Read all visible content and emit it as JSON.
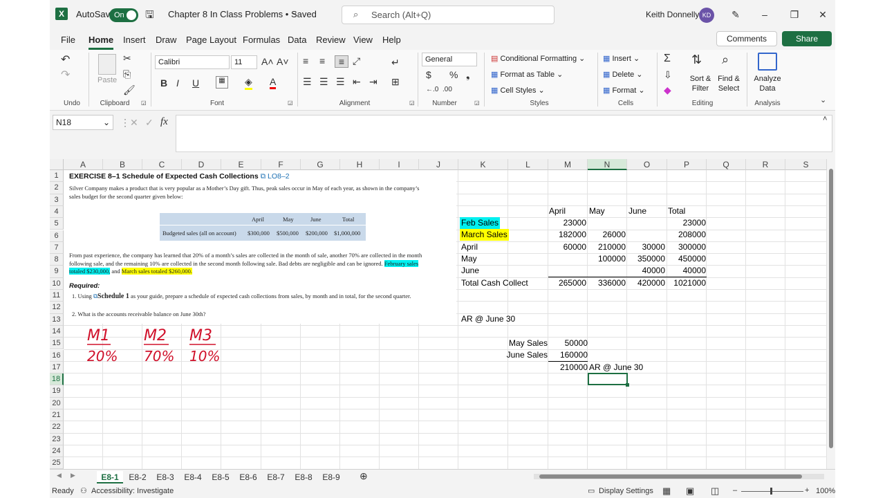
{
  "title_bar": {
    "autosave_label": "AutoSave",
    "autosave_state": "On",
    "doc_title": "Chapter 8 In Class Problems • Saved",
    "search_placeholder": "Search (Alt+Q)",
    "user_name": "Keith Donnelly",
    "user_initials": "KD"
  },
  "menu": [
    "File",
    "Home",
    "Insert",
    "Draw",
    "Page Layout",
    "Formulas",
    "Data",
    "Review",
    "View",
    "Help"
  ],
  "menu_active": "Home",
  "comments_label": "Comments",
  "share_label": "Share",
  "ribbon": {
    "undo_label": "Undo",
    "paste_label": "Paste",
    "clipboard_label": "Clipboard",
    "font_name": "Calibri",
    "font_size": "11",
    "font_label": "Font",
    "alignment_label": "Alignment",
    "number_format": "General",
    "number_label": "Number",
    "cond_format": "Conditional Formatting",
    "format_table": "Format as Table",
    "cell_styles": "Cell Styles",
    "styles_label": "Styles",
    "insert": "Insert",
    "delete": "Delete",
    "format": "Format",
    "cells_label": "Cells",
    "sort_filter_1": "Sort &",
    "sort_filter_2": "Filter",
    "find_select_1": "Find &",
    "find_select_2": "Select",
    "editing_label": "Editing",
    "analyze_1": "Analyze",
    "analyze_2": "Data",
    "analysis_label": "Analysis"
  },
  "name_box": "N18",
  "columns": [
    "A",
    "B",
    "C",
    "D",
    "E",
    "F",
    "G",
    "H",
    "I",
    "J",
    "K",
    "L",
    "M",
    "N",
    "O",
    "P",
    "Q",
    "R",
    "S"
  ],
  "rows": [
    "1",
    "2",
    "3",
    "4",
    "5",
    "6",
    "7",
    "8",
    "9",
    "10",
    "11",
    "12",
    "13",
    "14",
    "15",
    "16",
    "17",
    "18",
    "19",
    "20",
    "21",
    "22",
    "23",
    "24",
    "25"
  ],
  "exercise": {
    "heading": "EXERCISE 8–1 Schedule of Expected Cash Collections",
    "lo": "LO8–2",
    "intro": "Silver Company makes a product that is very popular as a Mother’s Day gift. Thus, peak sales occur in May of each year, as shown in the company’s sales budget for the second quarter given below:",
    "table_headers": [
      "April",
      "May",
      "June",
      "Total"
    ],
    "table_row_label": "Budgeted sales (all on account)",
    "table_values": [
      "$300,000",
      "$500,000",
      "$200,000",
      "$1,000,000"
    ],
    "para1": "From past experience, the company has learned that 20% of a month’s sales are collected in the month of sale, another 70% are collected in the month following sale, and the remaining 10% are collected in the second month following sale. Bad debts are negligible and can be ignored.",
    "feb_text": "February sales totaled $230,000,",
    "and_text": " and ",
    "mar_text": "March sales totaled $260,000.",
    "required": "Required:",
    "req1_a": "1. Using",
    "req1_b": "Schedule 1",
    "req1_c": "as your guide, prepare a schedule of expected cash collections from sales, by month and in total, for the second quarter.",
    "req2": "2. What is the accounts receivable balance on June 30th?"
  },
  "handwriting": [
    "M1",
    "20%",
    "M2",
    "70%",
    "M3",
    "10%"
  ],
  "schedule": {
    "headers": [
      "April",
      "May",
      "June",
      "Total"
    ],
    "rows": [
      {
        "label": "Feb Sales",
        "values": [
          "23000",
          "",
          "",
          "23000"
        ]
      },
      {
        "label": "March Sales",
        "values": [
          "182000",
          "26000",
          "",
          "208000"
        ]
      },
      {
        "label": "April",
        "values": [
          "60000",
          "210000",
          "30000",
          "300000"
        ]
      },
      {
        "label": "May",
        "values": [
          "",
          "100000",
          "350000",
          "450000"
        ]
      },
      {
        "label": "June",
        "values": [
          "",
          "",
          "40000",
          "40000"
        ]
      },
      {
        "label": "Total Cash Collect",
        "values": [
          "265000",
          "336000",
          "420000",
          "1021000"
        ]
      }
    ],
    "ar_label": "AR @ June 30",
    "may_sales_label": "May Sales",
    "may_sales_value": "50000",
    "june_sales_label": "June Sales",
    "june_sales_value": "160000",
    "ar_total": "210000",
    "ar_total_label": "AR @ June 30"
  },
  "tabs": [
    "E8-1",
    "E8-2",
    "E8-3",
    "E8-4",
    "E8-5",
    "E8-6",
    "E8-7",
    "E8-8",
    "E8-9"
  ],
  "active_tab": "E8-1",
  "status": {
    "ready": "Ready",
    "accessibility": "Accessibility: Investigate",
    "display_settings": "Display Settings",
    "zoom": "100%"
  },
  "colors": {
    "excel_green": "#1d6f42",
    "highlight_cyan": "#00f0f0",
    "highlight_yellow": "#ffff00",
    "ink_red": "#d0102a"
  }
}
